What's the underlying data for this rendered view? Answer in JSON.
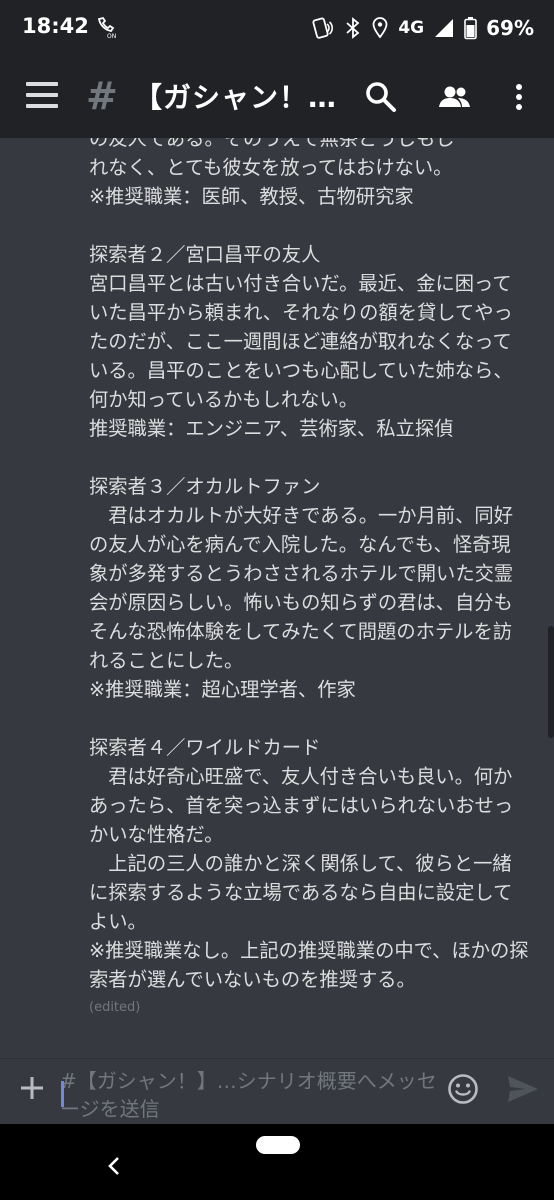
{
  "status_bar": {
    "time": "18:42",
    "network": "4G",
    "battery": "69%",
    "icons": [
      "call-forwarding-icon",
      "nfc-icon",
      "bluetooth-icon",
      "location-icon",
      "signal-icon",
      "battery-icon"
    ]
  },
  "app_bar": {
    "channel_title": "【ガシャン！…",
    "icons": [
      "menu-icon",
      "hash-icon",
      "search-icon",
      "members-icon",
      "more-vert-icon"
    ]
  },
  "message": {
    "partial_top": "の友人である。そのうえで無茶どうしもし",
    "p1_line1": "れなく、とても彼女を放ってはおけない。",
    "p1_line2": "※推奨職業：医師、教授、古物研究家",
    "inv2_title": "探索者２／宮口昌平の友人",
    "inv2_text": "宮口昌平とは古い付き合いだ。最近、金に困っていた昌平から頼まれ、それなりの額を貸してやったのだが、ここ一週間ほど連絡が取れなくなっている。昌平のことをいつも心配していた姉なら、何か知っているかもしれない。",
    "inv2_jobs": "推奨職業：エンジニア、芸術家、私立探偵",
    "inv3_title": "探索者３／オカルトファン",
    "inv3_text": "　君はオカルトが大好きである。一か月前、同好の友人が心を病んで入院した。なんでも、怪奇現象が多発するとうわさされるホテルで開いた交霊会が原因らしい。怖いもの知らずの君は、自分もそんな恐怖体験をしてみたくて問題のホテルを訪れることにした。",
    "inv3_jobs": "※推奨職業：超心理学者、作家",
    "inv4_title": "探索者４／ワイルドカード",
    "inv4_text1": "　君は好奇心旺盛で、友人付き合いも良い。何かあったら、首を突っ込まずにはいられないおせっかいな性格だ。",
    "inv4_text2": "　上記の三人の誰かと深く関係して、彼らと一緒に探索するような立場であるなら自由に設定してよい。",
    "inv4_jobs": "※推奨職業なし。上記の推奨職業の中で、ほかの探索者が選んでいないものを推奨する。",
    "edited_label": "(edited)"
  },
  "composer": {
    "placeholder": "#【ガシャン！】…シナリオ概要へメッセージを送信",
    "icons": [
      "add-icon",
      "emoji-icon",
      "send-icon"
    ]
  },
  "colors": {
    "background": "#36393f",
    "bars": "#202225",
    "text": "#dcddde",
    "muted": "#72767d",
    "accent": "#7289da"
  }
}
